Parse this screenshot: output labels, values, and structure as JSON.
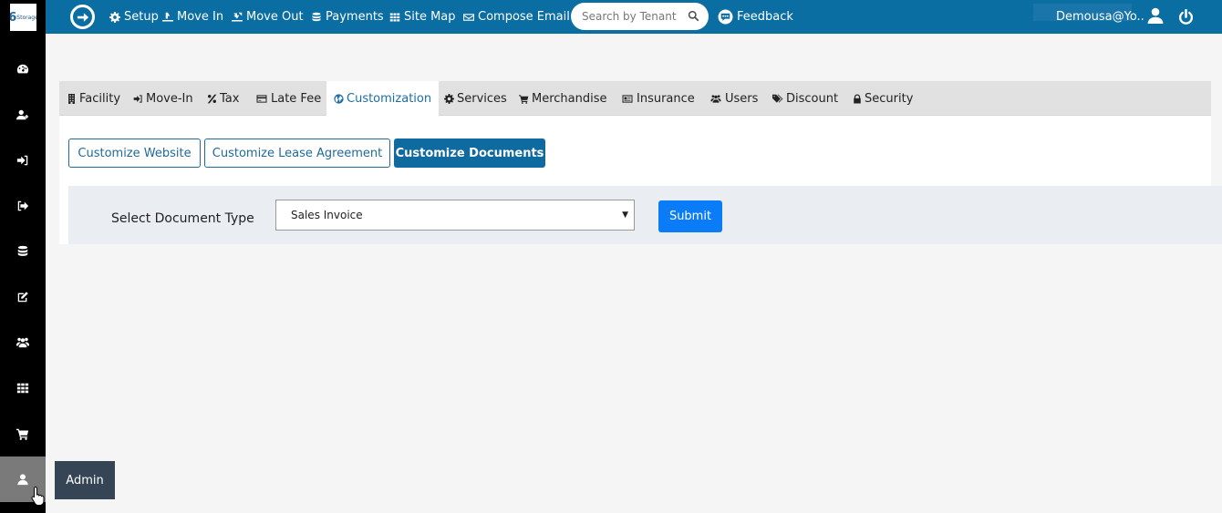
{
  "brand": {
    "logo_text": "Storage",
    "logo_mark": "6"
  },
  "topbar": {
    "nav": [
      {
        "label": "Setup",
        "icon": "gear-icon"
      },
      {
        "label": "Move In",
        "icon": "move-in-icon"
      },
      {
        "label": "Move Out",
        "icon": "move-out-icon"
      },
      {
        "label": "Payments",
        "icon": "database-icon"
      },
      {
        "label": "Site Map",
        "icon": "grid-icon"
      },
      {
        "label": "Compose Email",
        "icon": "envelope-icon"
      }
    ],
    "search_placeholder": "Search by Tenant",
    "feedback_label": "Feedback",
    "user_name": "Demousa@Yo.."
  },
  "sidebar": {
    "items": [
      {
        "name": "dashboard",
        "icon": "dashboard-icon"
      },
      {
        "name": "add-tenant",
        "icon": "user-plus-icon"
      },
      {
        "name": "move-in",
        "icon": "sign-in-icon"
      },
      {
        "name": "move-out",
        "icon": "sign-out-icon"
      },
      {
        "name": "payments",
        "icon": "database-icon"
      },
      {
        "name": "edit",
        "icon": "edit-icon"
      },
      {
        "name": "users",
        "icon": "users-icon"
      },
      {
        "name": "site-map",
        "icon": "grid-icon"
      },
      {
        "name": "merchandise",
        "icon": "cart-icon"
      },
      {
        "name": "admin",
        "icon": "user-icon",
        "active": true
      }
    ],
    "tooltip": "Admin"
  },
  "tabs": [
    {
      "label": "Facility",
      "icon": "building-icon"
    },
    {
      "label": "Move-In",
      "icon": "sign-in-icon"
    },
    {
      "label": "Tax",
      "icon": "percent-icon"
    },
    {
      "label": "Late Fee",
      "icon": "credit-card-icon"
    },
    {
      "label": "Customization",
      "icon": "globe-icon",
      "active": true
    },
    {
      "label": "Services",
      "icon": "gear-icon"
    },
    {
      "label": "Merchandise",
      "icon": "cart-icon"
    },
    {
      "label": "Insurance",
      "icon": "newspaper-icon"
    },
    {
      "label": "Users",
      "icon": "users-icon"
    },
    {
      "label": "Discount",
      "icon": "tags-icon"
    },
    {
      "label": "Security",
      "icon": "lock-icon"
    }
  ],
  "sub_buttons": [
    {
      "label": "Customize Website"
    },
    {
      "label": "Customize Lease Agreement"
    },
    {
      "label": "Customize Documents",
      "active": true
    }
  ],
  "form": {
    "label": "Select Document Type",
    "selected_value": "Sales Invoice",
    "submit_label": "Submit"
  },
  "colors": {
    "topbar": "#0a6ea3",
    "sidebar": "#000000",
    "active_tab_text": "#1b6ea6",
    "submit": "#0a7cf7",
    "tooltip": "#354555"
  }
}
